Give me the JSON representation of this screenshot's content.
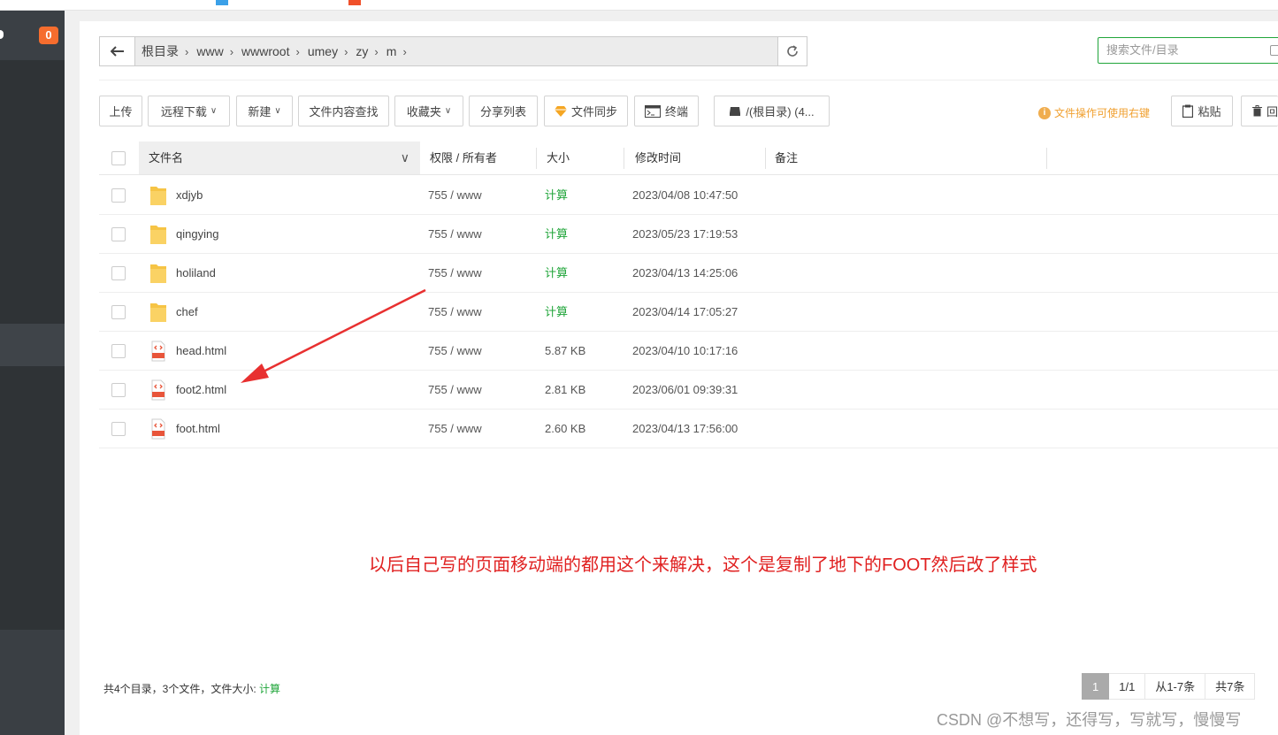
{
  "sidebar": {
    "badge": "0"
  },
  "path": {
    "crumbs": [
      "根目录",
      "www",
      "wwwroot",
      "umey",
      "zy",
      "m"
    ]
  },
  "search": {
    "placeholder": "搜索文件/目录"
  },
  "toolbar": {
    "upload": "上传",
    "remote_download": "远程下载",
    "new": "新建",
    "content_search": "文件内容查找",
    "favorites": "收藏夹",
    "share_list": "分享列表",
    "file_sync": "文件同步",
    "terminal": "终端",
    "disk": "/(根目录) (4...",
    "tip": "文件操作可使用右键",
    "paste": "粘贴",
    "recycle": "回"
  },
  "table": {
    "headers": {
      "name": "文件名",
      "perm": "权限 / 所有者",
      "size": "大小",
      "mtime": "修改时间",
      "remark": "备注"
    },
    "rows": [
      {
        "type": "folder",
        "name": "xdjyb",
        "perm": "755 / www",
        "size": "计算",
        "mtime": "2023/04/08 10:47:50"
      },
      {
        "type": "folder",
        "name": "qingying",
        "perm": "755 / www",
        "size": "计算",
        "mtime": "2023/05/23 17:19:53"
      },
      {
        "type": "folder",
        "name": "holiland",
        "perm": "755 / www",
        "size": "计算",
        "mtime": "2023/04/13 14:25:06"
      },
      {
        "type": "folder",
        "name": "chef",
        "perm": "755 / www",
        "size": "计算",
        "mtime": "2023/04/14 17:05:27"
      },
      {
        "type": "html",
        "name": "head.html",
        "perm": "755 / www",
        "size": "5.87 KB",
        "mtime": "2023/04/10 10:17:16"
      },
      {
        "type": "html",
        "name": "foot2.html",
        "perm": "755 / www",
        "size": "2.81 KB",
        "mtime": "2023/06/01 09:39:31"
      },
      {
        "type": "html",
        "name": "foot.html",
        "perm": "755 / www",
        "size": "2.60 KB",
        "mtime": "2023/04/13 17:56:00"
      }
    ]
  },
  "footer": {
    "summary": "共4个目录，3个文件，文件大小: ",
    "calc": "计算"
  },
  "pager": {
    "current": "1",
    "pages": "1/1",
    "range": "从1-7条",
    "total": "共7条"
  },
  "annotation": {
    "note": "以后自己写的页面移动端的都用这个来解决，这个是复制了地下的FOOT然后改了样式",
    "arrow_color": "#e83030"
  },
  "watermark": "CSDN @不想写，还得写，写就写，慢慢写",
  "colors": {
    "accent": "#20a53a",
    "badge": "#f66d2e",
    "annotation": "#e02020"
  }
}
